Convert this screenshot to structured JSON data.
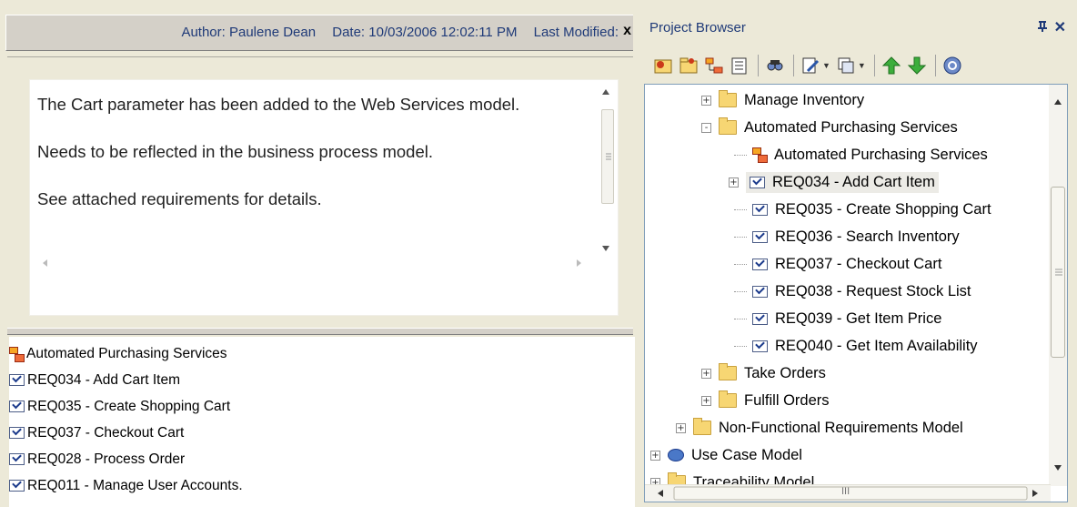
{
  "notes_panel": {
    "header": {
      "author": "Author: Paulene Dean",
      "date": "Date: 10/03/2006 12:02:11 PM",
      "modified": "Last Modified:",
      "close_glyph": "x"
    },
    "paragraphs": [
      "The Cart parameter has been added to the Web Services model.",
      "Needs to be reflected in the business process model.",
      "See attached requirements for details."
    ],
    "links": [
      {
        "icon": "diagram-icon",
        "label": "Automated Purchasing Services"
      },
      {
        "icon": "requirement-icon",
        "label": "REQ034 - Add Cart Item"
      },
      {
        "icon": "requirement-icon",
        "label": "REQ035 - Create Shopping Cart"
      },
      {
        "icon": "requirement-icon",
        "label": "REQ037 - Checkout Cart"
      },
      {
        "icon": "requirement-icon",
        "label": "REQ028 - Process Order"
      },
      {
        "icon": "requirement-icon",
        "label": "REQ011 - Manage User Accounts."
      }
    ]
  },
  "project_browser": {
    "title": "Project Browser",
    "pin_glyph": "ᴨ",
    "close_glyph": "✕",
    "toolbar": [
      "new-package-icon",
      "new-view-icon",
      "new-diagram-icon",
      "new-element-icon",
      "find-icon",
      "edit-icon",
      "copy-icon",
      "move-up-icon",
      "move-down-icon",
      "help-icon"
    ],
    "tree": [
      {
        "label": "Manage Inventory",
        "icon": "folder",
        "expander": "+",
        "indent": 1
      },
      {
        "label": "Automated Purchasing Services",
        "icon": "folder",
        "expander": "-",
        "indent": 1
      },
      {
        "label": "Automated Purchasing Services",
        "icon": "diagram",
        "expander": "",
        "indent": 2
      },
      {
        "label": "REQ034 - Add Cart Item",
        "icon": "requirement",
        "expander": "+",
        "indent": 2,
        "selected": true
      },
      {
        "label": "REQ035 - Create Shopping Cart",
        "icon": "requirement",
        "expander": "",
        "indent": 2
      },
      {
        "label": "REQ036 - Search Inventory",
        "icon": "requirement",
        "expander": "",
        "indent": 2
      },
      {
        "label": "REQ037 - Checkout Cart",
        "icon": "requirement",
        "expander": "",
        "indent": 2
      },
      {
        "label": "REQ038 - Request Stock List",
        "icon": "requirement",
        "expander": "",
        "indent": 2
      },
      {
        "label": "REQ039 - Get Item Price",
        "icon": "requirement",
        "expander": "",
        "indent": 2
      },
      {
        "label": "REQ040 - Get Item Availability",
        "icon": "requirement",
        "expander": "",
        "indent": 2
      },
      {
        "label": "Take Orders",
        "icon": "folder",
        "expander": "+",
        "indent": 1
      },
      {
        "label": "Fulfill Orders",
        "icon": "folder",
        "expander": "+",
        "indent": 1
      },
      {
        "label": "Non-Functional Requirements Model",
        "icon": "folder",
        "expander": "+",
        "indent": 0
      },
      {
        "label": "Use Case Model",
        "icon": "usecase",
        "expander": "+",
        "indent": -1
      },
      {
        "label": "Traceability Model",
        "icon": "folder",
        "expander": "+",
        "indent": -1
      }
    ],
    "hscroll_glyph": "III"
  },
  "colors": {
    "panel_bg": "#ece9d8",
    "title_text": "#1f3a78",
    "selection": "#ecebe6"
  }
}
